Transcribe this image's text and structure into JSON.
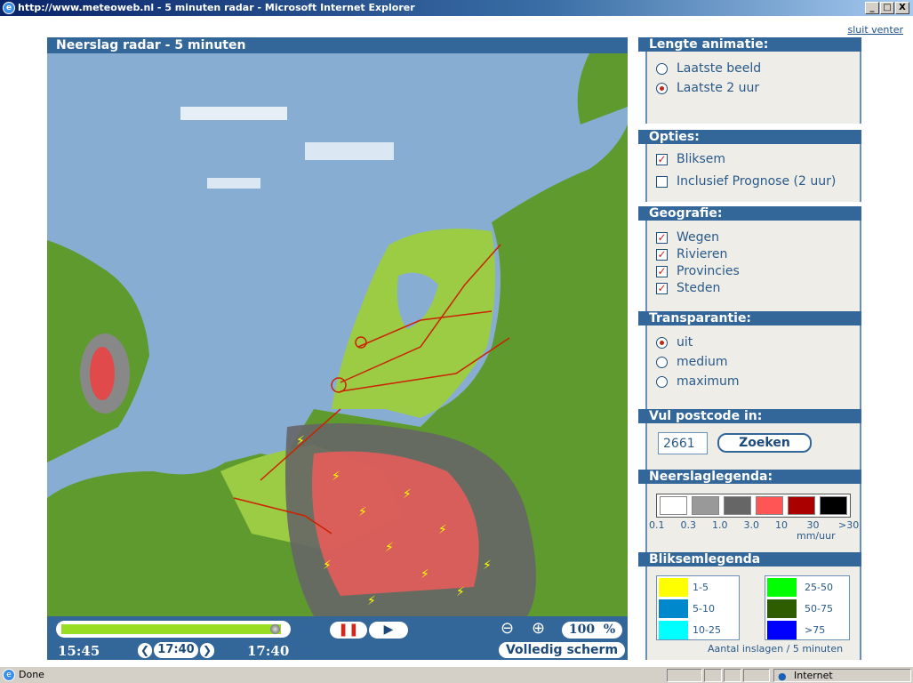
{
  "window": {
    "title": "http://www.meteoweb.nl - 5 minuten radar - Microsoft Internet Explorer",
    "minimize": "_",
    "maximize": "□",
    "close": "X"
  },
  "page": {
    "close_link": "sluit venter"
  },
  "map": {
    "title": "Neerslag radar - 5 minuten"
  },
  "controls": {
    "start_time": "15:45",
    "current_time": "17:40",
    "end_time": "17:40",
    "prev": "❮",
    "next": "❯",
    "zoom_level": "100",
    "zoom_unit": "%",
    "fullscreen": "Volledig scherm",
    "progress": 0.98
  },
  "sidebar": {
    "animation": {
      "title": "Lengte animatie:",
      "options": [
        {
          "label": "Laatste beeld",
          "selected": false
        },
        {
          "label": "Laatste 2 uur",
          "selected": true
        }
      ]
    },
    "options": {
      "title": "Opties:",
      "items": [
        {
          "label": "Bliksem",
          "checked": true
        },
        {
          "label": "Inclusief Prognose (2 uur)",
          "checked": false
        }
      ]
    },
    "geography": {
      "title": "Geografie:",
      "items": [
        {
          "label": "Wegen",
          "checked": true
        },
        {
          "label": "Rivieren",
          "checked": true
        },
        {
          "label": "Provincies",
          "checked": true
        },
        {
          "label": "Steden",
          "checked": true
        }
      ]
    },
    "transparency": {
      "title": "Transparantie:",
      "options": [
        {
          "label": "uit",
          "selected": true
        },
        {
          "label": "medium",
          "selected": false
        },
        {
          "label": "maximum",
          "selected": false
        }
      ]
    },
    "postcode": {
      "title": "Vul postcode in:",
      "value": "2661",
      "button": "Zoeken"
    },
    "rain_legend": {
      "title": "Neerslaglegenda:",
      "colors": [
        "#ffffff",
        "#999999",
        "#666666",
        "#ff5555",
        "#aa0000",
        "#000000"
      ],
      "ticks": [
        "0.1",
        "0.3",
        "1.0",
        "3.0",
        "10",
        "30",
        ">30"
      ],
      "unit": "mm/uur"
    },
    "lightning_legend": {
      "title": "Bliksemlegenda",
      "items": [
        {
          "label": "1-5",
          "color": "#ffff00"
        },
        {
          "label": "5-10",
          "color": "#0088cc"
        },
        {
          "label": "10-25",
          "color": "#00ffff"
        },
        {
          "label": "25-50",
          "color": "#00ff00"
        },
        {
          "label": "50-75",
          "color": "#2e5c00"
        },
        {
          "label": ">75",
          "color": "#0000ff"
        }
      ],
      "note": "Aantal inslagen / 5 minuten"
    }
  },
  "status": {
    "text": "Done",
    "zone": "Internet"
  }
}
